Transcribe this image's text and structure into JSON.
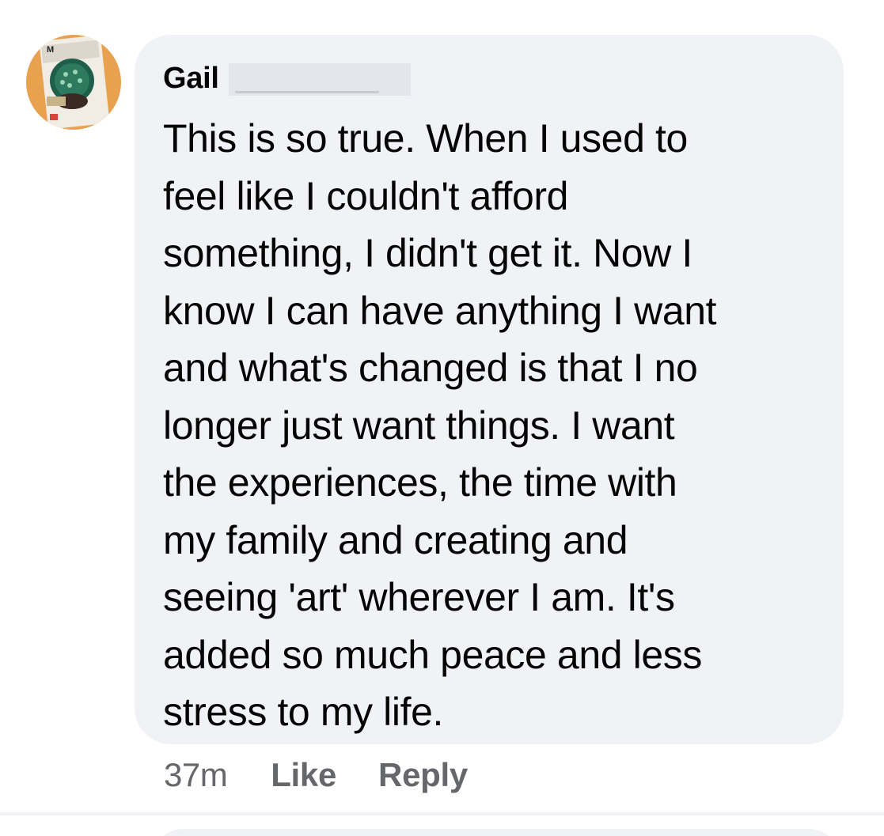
{
  "comment": {
    "author_first_name": "Gail",
    "avatar_icon": "profile-photo",
    "lines": [
      "This is so true. When I used to",
      "feel like I couldn't afford",
      "something, I didn't get it. Now I",
      "know I can have anything I want",
      "and what's changed is that I no",
      "longer just want things. I want",
      "the experiences, the time with",
      "my family and creating and",
      "seeing 'art' wherever I am. It's",
      "added so much peace and less",
      "stress to my life."
    ],
    "timestamp": "37m",
    "like_label": "Like",
    "reply_label": "Reply"
  },
  "colors": {
    "bubble_background": "#f0f2f5",
    "text_primary": "#050505",
    "text_secondary": "#65676b",
    "redaction": "#e4e6eb"
  }
}
